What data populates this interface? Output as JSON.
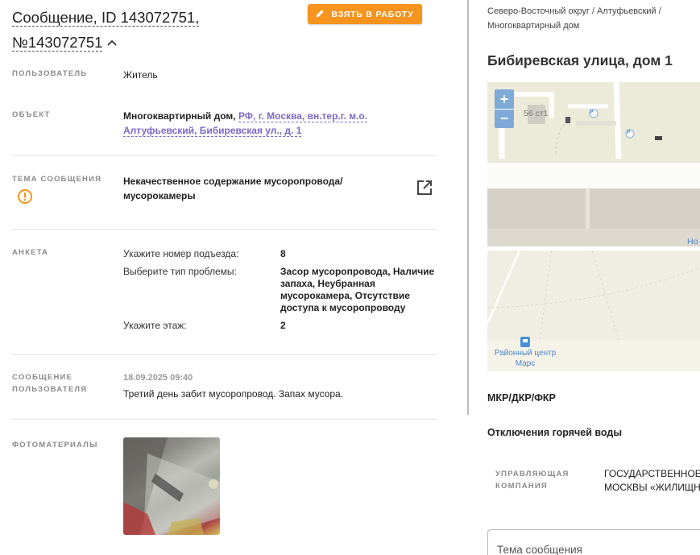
{
  "header": {
    "title": "Сообщение, ID 143072751, №143072751",
    "take_button": "ВЗЯТЬ В РАБОТУ"
  },
  "fields": {
    "user_label": "ПОЛЬЗОВАТЕЛЬ",
    "user_value": "Житель",
    "object_label": "ОБЪЕКТ",
    "object_type": "Многоквартирный дом,",
    "object_address_line1": "РФ, г. Москва, вн.тер.г. м.о.",
    "object_address_line2": "Алтуфьевский, Бибиревская ул., д. 1",
    "topic_label": "ТЕМА СООБЩЕНИЯ",
    "topic_line1": "Некачественное содержание мусоропровода/",
    "topic_line2": "мусорокамеры",
    "survey_label": "АНКЕТА",
    "survey": [
      {
        "question": "Укажите номер подъезда:",
        "answer": "8"
      },
      {
        "question": "Выберите тип проблемы:",
        "answer": "Засор мусоропровода, Наличие запаха, Неубранная мусорокамера, Отсутствие доступа к мусоропроводу"
      },
      {
        "question": "Укажите этаж:",
        "answer": "2"
      }
    ],
    "message_label": "СООБЩЕНИЕ ПОЛЬЗОВАТЕЛЯ",
    "message_time": "18.09.2025 09:40",
    "message_text": "Третий день забит мусоропровод. Запах мусора.",
    "photos_label": "ФОТОМАТЕРИАЛЫ"
  },
  "right": {
    "breadcrumb_line1": "Северо-Восточный округ / Алтуфьевский /",
    "breadcrumb_line2": "Многоквартирный дом",
    "address_title": "Бибиревская улица, дом 1",
    "map": {
      "building_label": "56 ст1",
      "poi_label_line1": "Районный центр",
      "poi_label_line2": "Марс",
      "edge_label": "Ho",
      "zoom_in": "+",
      "zoom_out": "−"
    },
    "section_mkr": "МКР/ДКР/ФКР",
    "section_hot_water": "Отключения горячей воды",
    "management_label_line1": "УПРАВЛЯЮЩАЯ",
    "management_label_line2": "КОМПАНИЯ",
    "management_value_line1": "ГОСУДАРСТВЕННОЕ",
    "management_value_line2": "МОСКВЫ «ЖИЛИЩН",
    "topic_input_placeholder": "Тема сообщения"
  },
  "colors": {
    "accent_orange": "#f7941d",
    "link_purple": "#7b68c8",
    "warning_orange": "#f7941d"
  }
}
